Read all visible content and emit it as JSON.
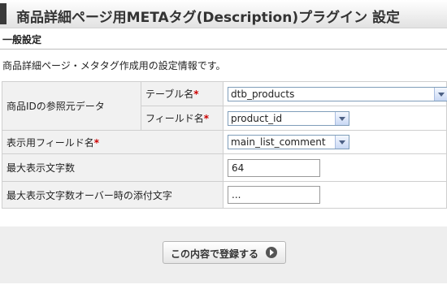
{
  "page": {
    "title": "商品詳細ページ用METAタグ(Description)プラグイン 設定"
  },
  "section": {
    "heading": "一般設定",
    "description": "商品詳細ページ・メタタグ作成用の設定情報です。"
  },
  "form": {
    "source_group_label": "商品IDの参照元データ",
    "table_name_label": "テーブル名",
    "table_name_value": "dtb_products",
    "field_name_label": "フィールド名",
    "field_name_value": "product_id",
    "display_field_label": "表示用フィールド名",
    "display_field_value": "main_list_comment",
    "max_chars_label": "最大表示文字数",
    "max_chars_value": "64",
    "suffix_label": "最大表示文字数オーバー時の添付文字",
    "suffix_value": "...",
    "required_mark": "*"
  },
  "actions": {
    "submit_label": "この内容で登録する"
  },
  "icons": {
    "submit": "arrow-right-circle-icon",
    "dropdown": "chevron-down-icon"
  }
}
